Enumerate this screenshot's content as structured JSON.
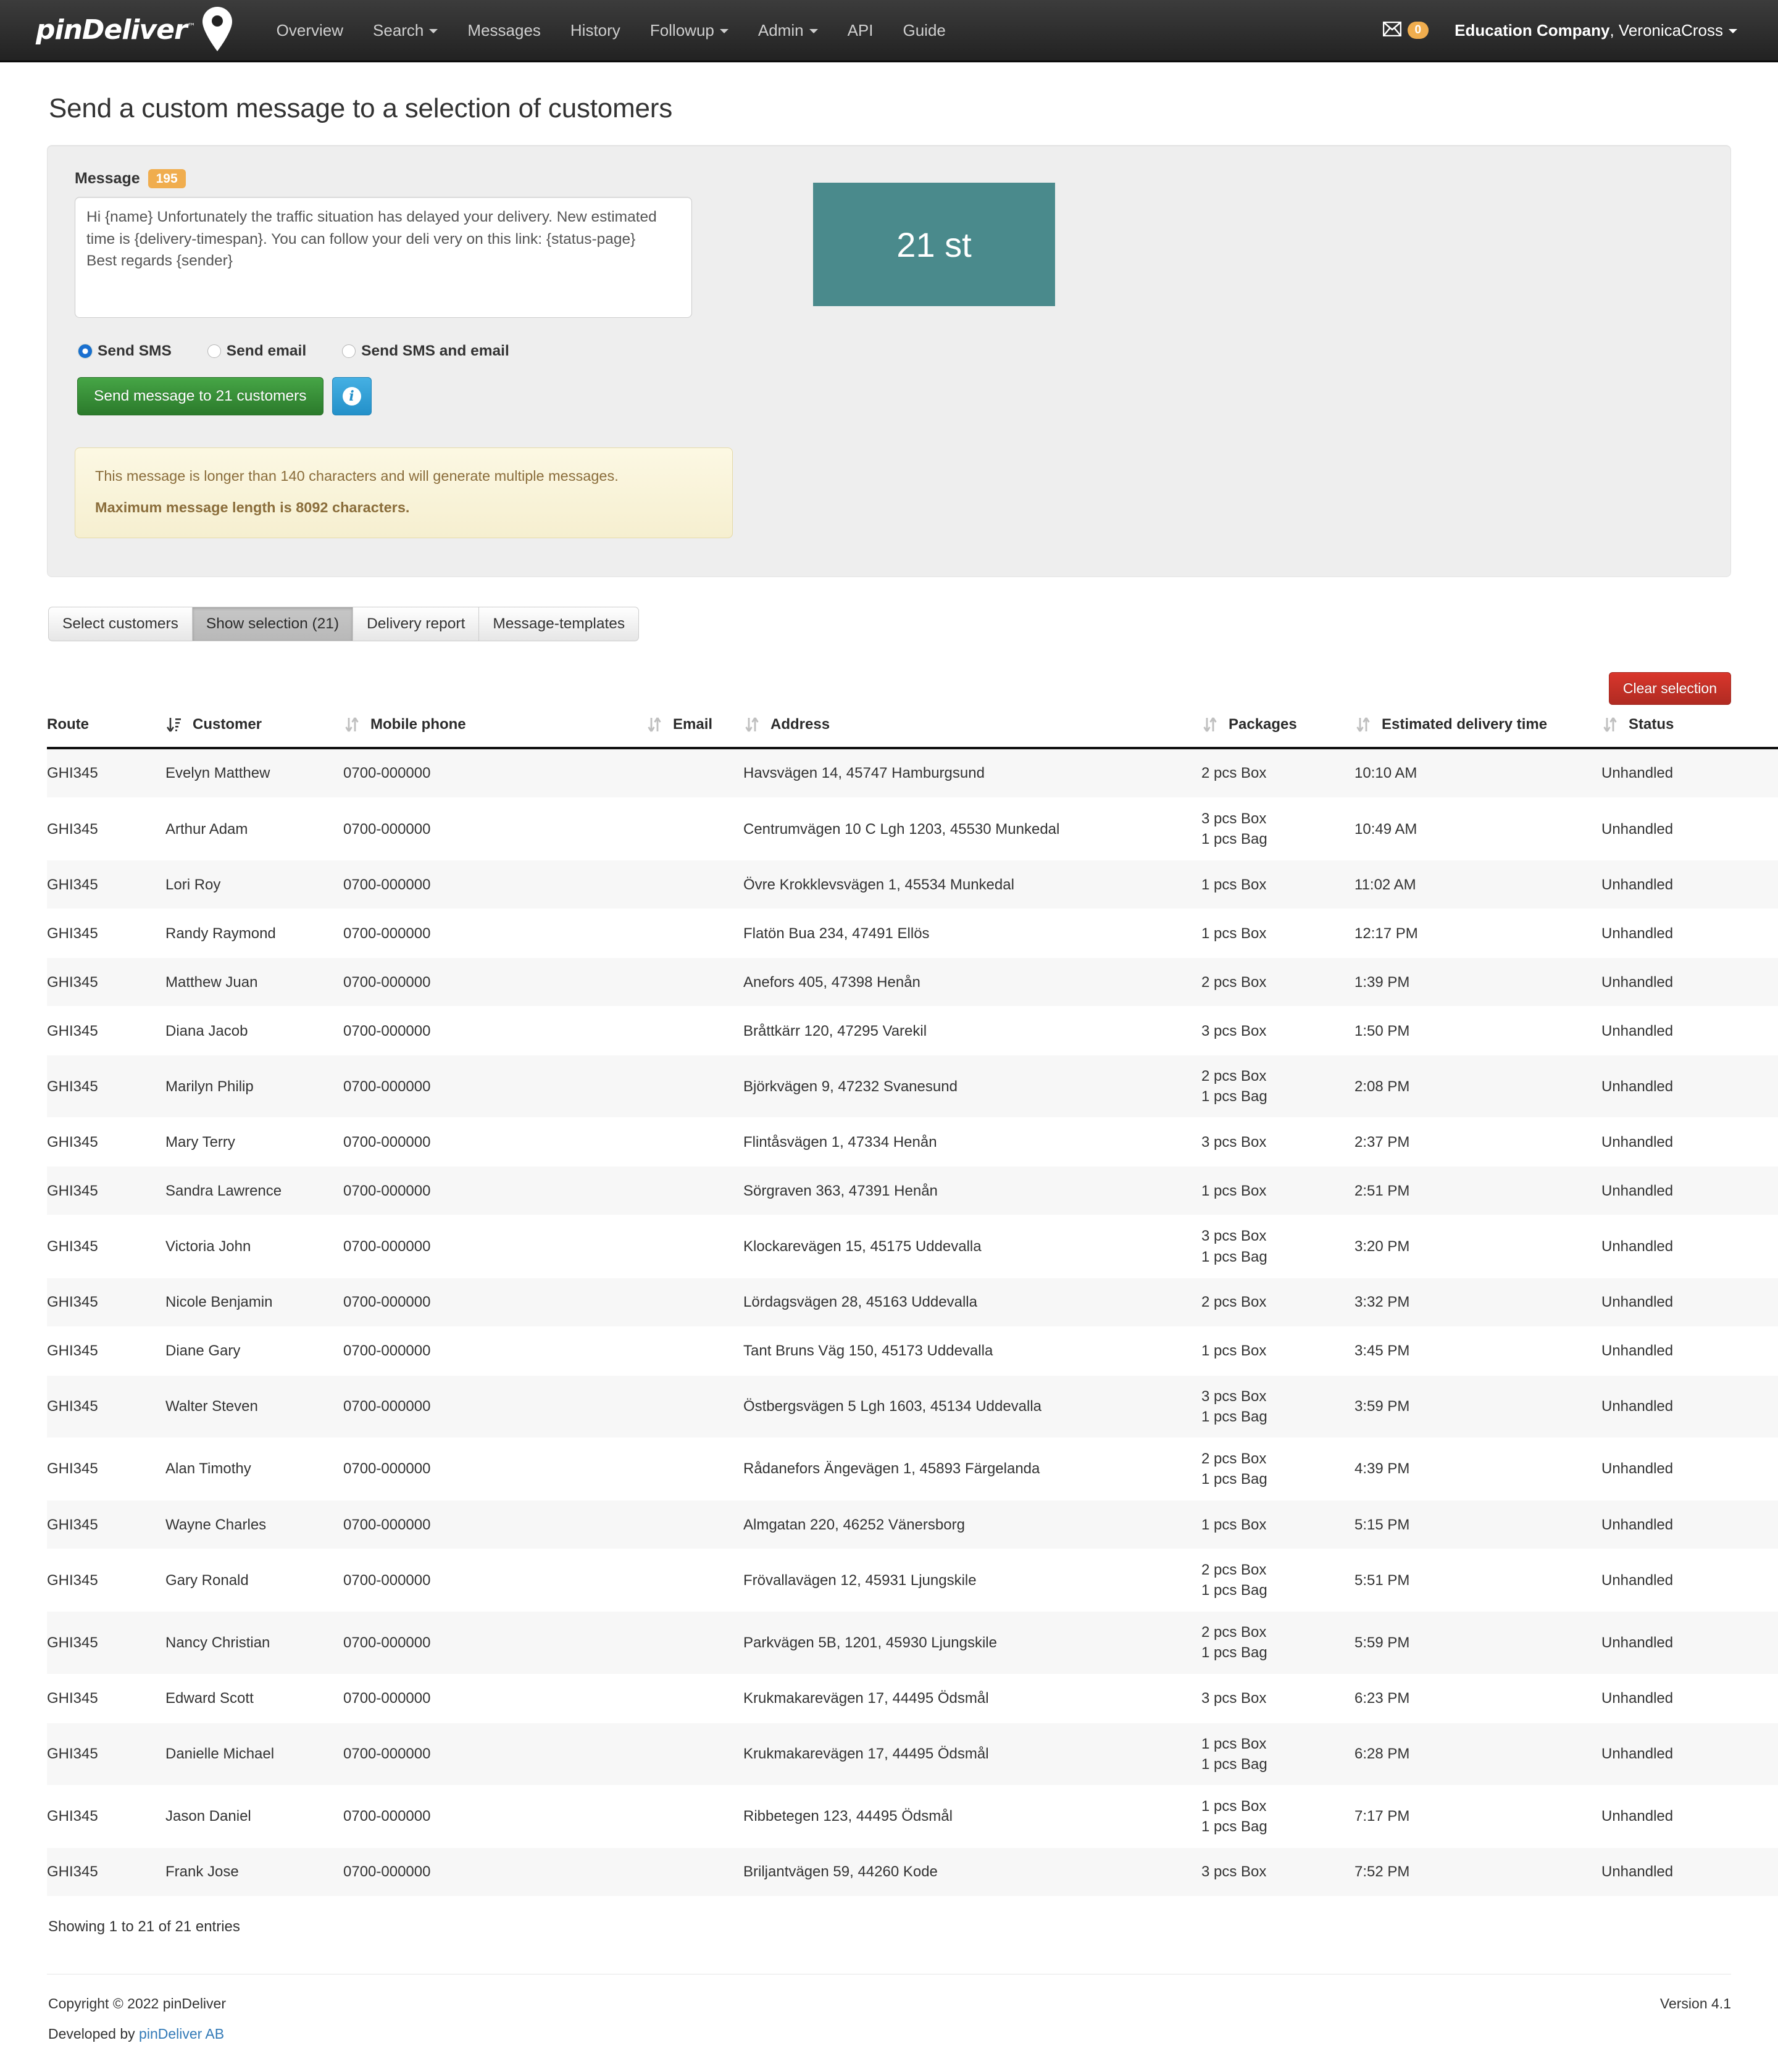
{
  "navbar": {
    "brand": {
      "text": "pinDeliver",
      "tm": "™",
      "icon": "map-pin-icon"
    },
    "links": [
      {
        "label": "Overview",
        "caret": false
      },
      {
        "label": "Search",
        "caret": true
      },
      {
        "label": "Messages",
        "caret": false
      },
      {
        "label": "History",
        "caret": false
      },
      {
        "label": "Followup",
        "caret": true
      },
      {
        "label": "Admin",
        "caret": true
      },
      {
        "label": "API",
        "caret": false
      },
      {
        "label": "Guide",
        "caret": false
      }
    ],
    "messages_badge": "0",
    "user": {
      "company": "Education Company",
      "name": "VeronicaCross",
      "separator": ", "
    }
  },
  "page": {
    "title": "Send a custom message to a selection of customers"
  },
  "message_panel": {
    "label": "Message",
    "char_count": "195",
    "textarea_value": "Hi {name} Unfortunately the traffic situation has delayed your delivery. New estimated time is {delivery-timespan}. You can follow your deli very on this link: {status-page}\nBest regards {sender}",
    "textarea_placeholder": "",
    "count_box": "21 st",
    "count_box_color": "#4a8a8c",
    "radios": [
      {
        "label": "Send SMS",
        "checked": true
      },
      {
        "label": "Send email",
        "checked": false
      },
      {
        "label": "Send SMS and email",
        "checked": false
      }
    ],
    "send_button": "Send message to 21 customers",
    "info_button": "i",
    "alert_line1": "This message is longer than 140 characters and will generate multiple messages.",
    "alert_line2": "Maximum message length is 8092 characters."
  },
  "tabs": [
    {
      "label": "Select customers",
      "active": false
    },
    {
      "label": "Show selection (21)",
      "active": true
    },
    {
      "label": "Delivery report",
      "active": false
    },
    {
      "label": "Message-templates",
      "active": false
    }
  ],
  "table": {
    "clear_button": "Clear selection",
    "columns": [
      "Route",
      "Customer",
      "Mobile phone",
      "Email",
      "Address",
      "Packages",
      "Estimated delivery time",
      "Status",
      ""
    ],
    "rows": [
      {
        "route": "GHI345",
        "customer": "Evelyn Matthew",
        "phone": "0700-000000",
        "email": "",
        "address": "Havsvägen 14, 45747 Hamburgsund",
        "packages": "2 pcs Box",
        "eta": "10:10 AM",
        "status": "Unhandled"
      },
      {
        "route": "GHI345",
        "customer": "Arthur Adam",
        "phone": "0700-000000",
        "email": "",
        "address": "Centrumvägen 10 C Lgh 1203, 45530 Munkedal",
        "packages": "3 pcs Box\n1 pcs Bag",
        "eta": "10:49 AM",
        "status": "Unhandled"
      },
      {
        "route": "GHI345",
        "customer": "Lori Roy",
        "phone": "0700-000000",
        "email": "",
        "address": "Övre Krokklevsvägen 1, 45534 Munkedal",
        "packages": "1 pcs Box",
        "eta": "11:02 AM",
        "status": "Unhandled"
      },
      {
        "route": "GHI345",
        "customer": "Randy Raymond",
        "phone": "0700-000000",
        "email": "",
        "address": "Flatön Bua 234, 47491 Ellös",
        "packages": "1 pcs Box",
        "eta": "12:17 PM",
        "status": "Unhandled"
      },
      {
        "route": "GHI345",
        "customer": "Matthew Juan",
        "phone": "0700-000000",
        "email": "",
        "address": "Anefors 405, 47398 Henån",
        "packages": "2 pcs Box",
        "eta": "1:39 PM",
        "status": "Unhandled"
      },
      {
        "route": "GHI345",
        "customer": "Diana Jacob",
        "phone": "0700-000000",
        "email": "",
        "address": "Bråttkärr 120, 47295 Varekil",
        "packages": "3 pcs Box",
        "eta": "1:50 PM",
        "status": "Unhandled"
      },
      {
        "route": "GHI345",
        "customer": "Marilyn Philip",
        "phone": "0700-000000",
        "email": "",
        "address": "Björkvägen 9, 47232 Svanesund",
        "packages": "2 pcs Box\n1 pcs Bag",
        "eta": "2:08 PM",
        "status": "Unhandled"
      },
      {
        "route": "GHI345",
        "customer": "Mary Terry",
        "phone": "0700-000000",
        "email": "",
        "address": "Flintåsvägen 1, 47334 Henån",
        "packages": "3 pcs Box",
        "eta": "2:37 PM",
        "status": "Unhandled"
      },
      {
        "route": "GHI345",
        "customer": "Sandra Lawrence",
        "phone": "0700-000000",
        "email": "",
        "address": "Sörgraven 363, 47391 Henån",
        "packages": "1 pcs Box",
        "eta": "2:51 PM",
        "status": "Unhandled"
      },
      {
        "route": "GHI345",
        "customer": "Victoria John",
        "phone": "0700-000000",
        "email": "",
        "address": "Klockarevägen 15, 45175 Uddevalla",
        "packages": "3 pcs Box\n1 pcs Bag",
        "eta": "3:20 PM",
        "status": "Unhandled"
      },
      {
        "route": "GHI345",
        "customer": "Nicole Benjamin",
        "phone": "0700-000000",
        "email": "",
        "address": "Lördagsvägen 28, 45163 Uddevalla",
        "packages": "2 pcs Box",
        "eta": "3:32 PM",
        "status": "Unhandled"
      },
      {
        "route": "GHI345",
        "customer": "Diane Gary",
        "phone": "0700-000000",
        "email": "",
        "address": "Tant Bruns Väg 150, 45173 Uddevalla",
        "packages": "1 pcs Box",
        "eta": "3:45 PM",
        "status": "Unhandled"
      },
      {
        "route": "GHI345",
        "customer": "Walter Steven",
        "phone": "0700-000000",
        "email": "",
        "address": "Östbergsvägen 5 Lgh 1603, 45134 Uddevalla",
        "packages": "3 pcs Box\n1 pcs Bag",
        "eta": "3:59 PM",
        "status": "Unhandled"
      },
      {
        "route": "GHI345",
        "customer": "Alan Timothy",
        "phone": "0700-000000",
        "email": "",
        "address": "Rådanefors Ängevägen 1, 45893 Färgelanda",
        "packages": "2 pcs Box\n1 pcs Bag",
        "eta": "4:39 PM",
        "status": "Unhandled"
      },
      {
        "route": "GHI345",
        "customer": "Wayne Charles",
        "phone": "0700-000000",
        "email": "",
        "address": "Almgatan 220, 46252 Vänersborg",
        "packages": "1 pcs Box",
        "eta": "5:15 PM",
        "status": "Unhandled"
      },
      {
        "route": "GHI345",
        "customer": "Gary Ronald",
        "phone": "0700-000000",
        "email": "",
        "address": "Frövallavägen 12, 45931 Ljungskile",
        "packages": "2 pcs Box\n1 pcs Bag",
        "eta": "5:51 PM",
        "status": "Unhandled"
      },
      {
        "route": "GHI345",
        "customer": "Nancy Christian",
        "phone": "0700-000000",
        "email": "",
        "address": "Parkvägen 5B, 1201, 45930 Ljungskile",
        "packages": "2 pcs Box\n1 pcs Bag",
        "eta": "5:59 PM",
        "status": "Unhandled"
      },
      {
        "route": "GHI345",
        "customer": "Edward Scott",
        "phone": "0700-000000",
        "email": "",
        "address": "Krukmakarevägen 17, 44495 Ödsmål",
        "packages": "3 pcs Box",
        "eta": "6:23 PM",
        "status": "Unhandled"
      },
      {
        "route": "GHI345",
        "customer": "Danielle Michael",
        "phone": "0700-000000",
        "email": "",
        "address": "Krukmakarevägen 17, 44495 Ödsmål",
        "packages": "1 pcs Box\n1 pcs Bag",
        "eta": "6:28 PM",
        "status": "Unhandled"
      },
      {
        "route": "GHI345",
        "customer": "Jason Daniel",
        "phone": "0700-000000",
        "email": "",
        "address": "Ribbetegen 123, 44495 Ödsmål",
        "packages": "1 pcs Box\n1 pcs Bag",
        "eta": "7:17 PM",
        "status": "Unhandled"
      },
      {
        "route": "GHI345",
        "customer": "Frank Jose",
        "phone": "0700-000000",
        "email": "",
        "address": "Briljantvägen 59, 44260 Kode",
        "packages": "3 pcs Box",
        "eta": "7:52 PM",
        "status": "Unhandled"
      }
    ],
    "row_delete_label": "✖",
    "showing": "Showing 1 to 21 of 21 entries"
  },
  "footer": {
    "copyright": "Copyright © 2022 pinDeliver",
    "version": "Version 4.1",
    "developed_prefix": "Developed by ",
    "developed_link": "pinDeliver AB"
  }
}
